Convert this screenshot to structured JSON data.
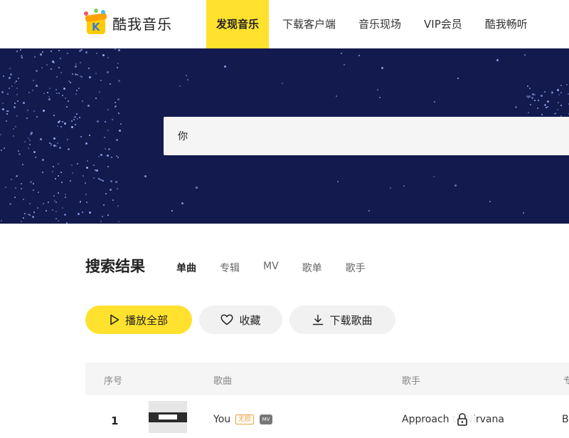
{
  "header": {
    "logo_text": "酷我音乐",
    "nav": [
      "发现音乐",
      "下载客户端",
      "音乐现场",
      "VIP会员",
      "酷我畅听"
    ]
  },
  "search": {
    "value": "你"
  },
  "results": {
    "title": "搜索结果",
    "tabs": [
      "单曲",
      "专辑",
      "MV",
      "歌单",
      "歌手"
    ]
  },
  "actions": {
    "play_all": "播放全部",
    "favorite": "收藏",
    "download": "下载歌曲"
  },
  "table": {
    "headers": {
      "index": "序号",
      "song": "歌曲",
      "artist": "歌手",
      "album": "专"
    },
    "rows": [
      {
        "index": "1",
        "song": "You",
        "lossless_badge": "无损",
        "mv_badge": "MV",
        "artist": "Approach to Nirvana",
        "album": "B"
      }
    ]
  },
  "colors": {
    "accent": "#ffe12e",
    "banner": "#131a4e"
  }
}
